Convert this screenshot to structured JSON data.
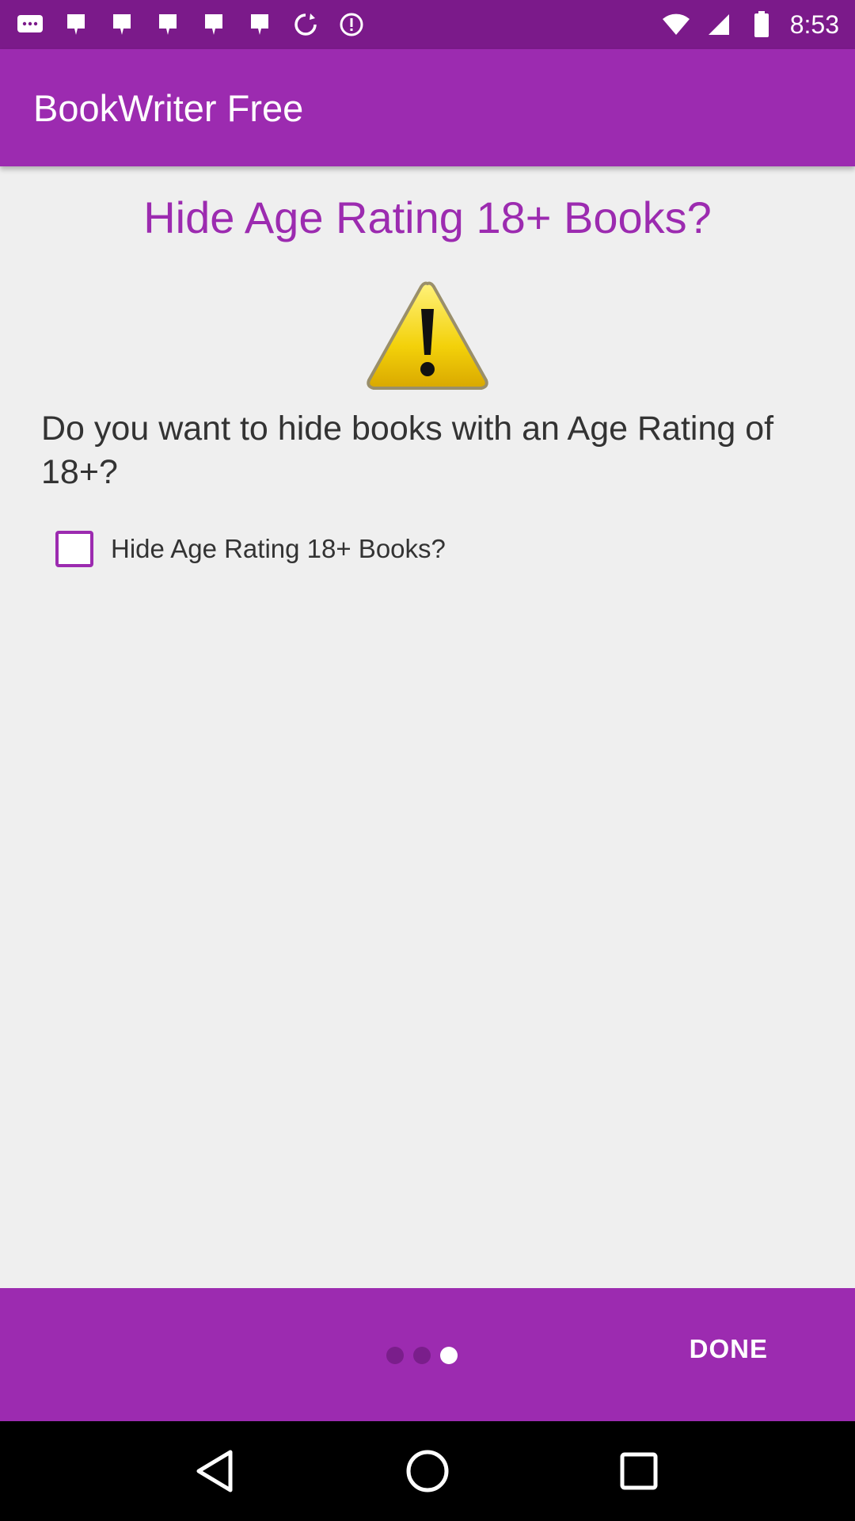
{
  "status_bar": {
    "time": "8:53",
    "left_icons": [
      "messages-icon",
      "notification-icon",
      "notification-icon",
      "notification-icon",
      "notification-icon",
      "notification-icon",
      "sync-icon",
      "info-icon"
    ],
    "right_icons": [
      "wifi-icon",
      "signal-icon",
      "battery-icon"
    ]
  },
  "app_bar": {
    "title": "BookWriter Free"
  },
  "main": {
    "heading": "Hide Age Rating 18+ Books?",
    "question": "Do you want to hide books with an Age Rating of 18+?",
    "checkbox": {
      "label": "Hide Age Rating 18+ Books?",
      "checked": false
    }
  },
  "bottom_bar": {
    "page_indicator": {
      "total": 3,
      "current": 3
    },
    "done_label": "DONE"
  },
  "colors": {
    "accent": "#9c2bb0",
    "status_bar": "#7b1a8a",
    "background": "#efefef"
  }
}
